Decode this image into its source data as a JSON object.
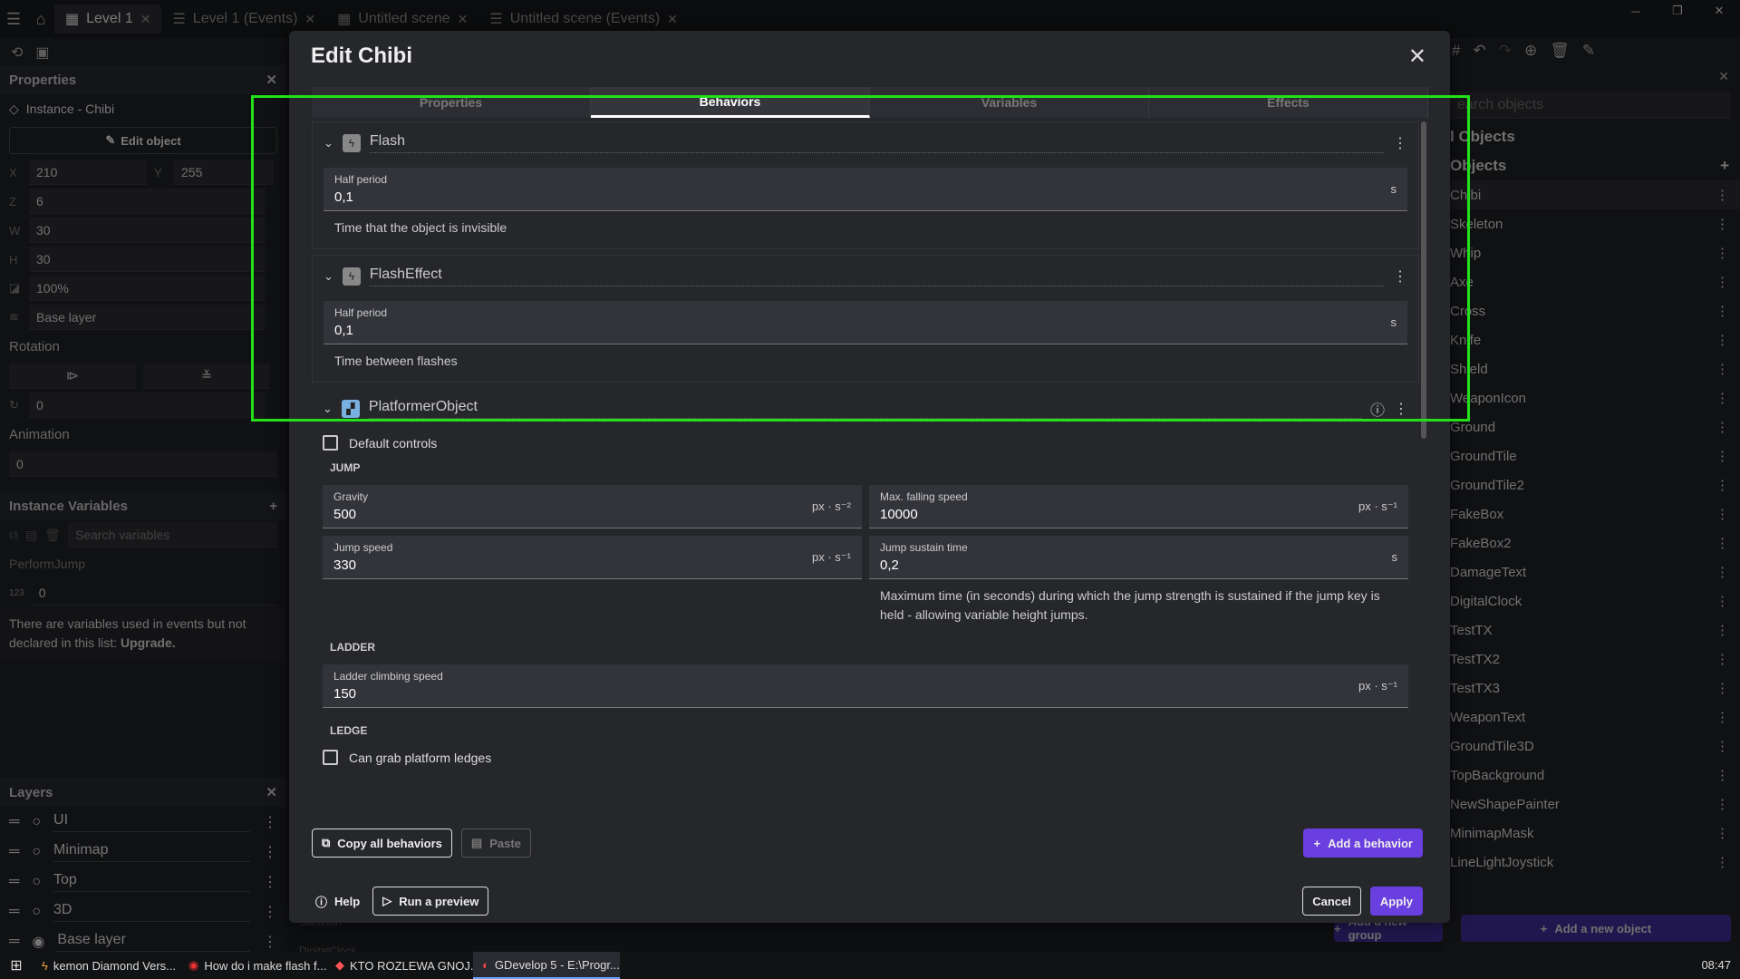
{
  "tabs": [
    {
      "label": "Level 1",
      "active": true
    },
    {
      "label": "Level 1 (Events)"
    },
    {
      "label": "Untitled scene"
    },
    {
      "label": "Untitled scene (Events)"
    }
  ],
  "left": {
    "properties_title": "Properties",
    "instance_label": "Instance  -  Chibi",
    "edit_object": "Edit object",
    "x_label": "X",
    "x": "210",
    "y_label": "Y",
    "y": "255",
    "z_label": "Z",
    "z": "6",
    "w_label": "W",
    "w": "30",
    "h_label": "H",
    "h": "30",
    "opacity": "100%",
    "layer": "Base layer",
    "rotation_title": "Rotation",
    "rotation": "0",
    "animation_title": "Animation",
    "animation": "0",
    "instance_vars_title": "Instance Variables",
    "search_vars_placeholder": "Search variables",
    "var_name": "PerformJump",
    "var_value": "0",
    "var_note": "There are variables used in events but not declared in this list:",
    "var_note_link": "Upgrade."
  },
  "layers": {
    "title": "Layers",
    "items": [
      "UI",
      "Minimap",
      "Top",
      "3D",
      "Base layer"
    ]
  },
  "right": {
    "search_placeholder": "earch objects",
    "global_title": "l Objects",
    "objects_title": "Objects",
    "objects": [
      "Chibi",
      "Skeleton",
      "Whip",
      "Axe",
      "Cross",
      "Knife",
      "Shield",
      "WeaponIcon",
      "Ground",
      "GroundTile",
      "GroundTile2",
      "FakeBox",
      "FakeBox2",
      "DamageText",
      "DigitalClock",
      "TestTX",
      "TestTX2",
      "TestTX3",
      "WeaponText",
      "GroundTile3D",
      "TopBackground",
      "NewShapePainter",
      "MinimapMask",
      "LineLightJoystick"
    ],
    "add_group": "Add a new group",
    "add_object": "Add a new object"
  },
  "dialog": {
    "title": "Edit Chibi",
    "tabs": [
      "Properties",
      "Behaviors",
      "Variables",
      "Effects"
    ],
    "flash": {
      "name": "Flash",
      "field_label": "Half period",
      "field_value": "0,1",
      "unit": "s",
      "desc": "Time that the object is invisible"
    },
    "flasheffect": {
      "name": "FlashEffect",
      "field_label": "Half period",
      "field_value": "0,1",
      "unit": "s",
      "desc": "Time between flashes"
    },
    "platformer": {
      "name": "PlatformerObject",
      "default_controls": "Default controls",
      "jump_group": "JUMP",
      "gravity_label": "Gravity",
      "gravity": "500",
      "gravity_unit": "px · s⁻²",
      "maxfall_label": "Max. falling speed",
      "maxfall": "10000",
      "maxfall_unit": "px · s⁻¹",
      "jumpspeed_label": "Jump speed",
      "jumpspeed": "330",
      "jumpspeed_unit": "px · s⁻¹",
      "sustain_label": "Jump sustain time",
      "sustain": "0,2",
      "sustain_unit": "s",
      "sustain_desc": "Maximum time (in seconds) during which the jump strength is sustained if the jump key is held - allowing variable height jumps.",
      "ladder_group": "LADDER",
      "ladder_label": "Ladder climbing speed",
      "ladder": "150",
      "ladder_unit": "px · s⁻¹",
      "ledge_group": "LEDGE",
      "grab_ledges": "Can grab platform ledges"
    },
    "copy_all": "Copy all behaviors",
    "paste": "Paste",
    "add_behavior": "Add a behavior",
    "help": "Help",
    "run_preview": "Run a preview",
    "cancel": "Cancel",
    "apply": "Apply"
  },
  "bg_rows": [
    "Skeleton",
    "DigitalClock"
  ],
  "taskbar": {
    "items": [
      "kemon Diamond Vers...",
      "How do i make flash f...",
      "KTO ROZLEWA GNOJ...",
      "GDevelop 5 - E:\\Progr..."
    ],
    "time": "08:47"
  }
}
